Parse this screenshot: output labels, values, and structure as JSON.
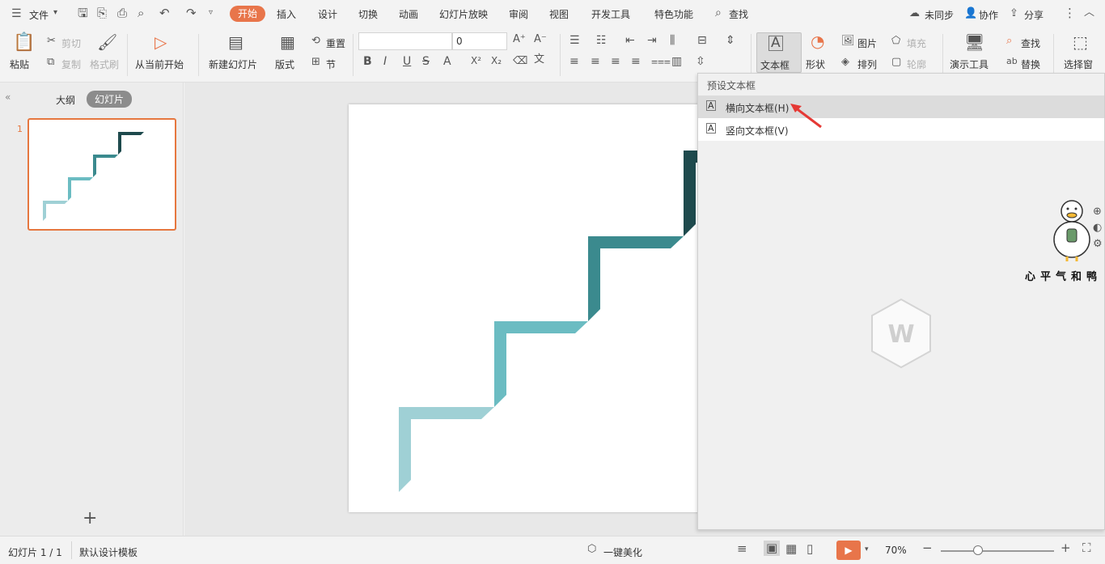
{
  "menubar": {
    "file": "文件",
    "tabs": [
      "开始",
      "插入",
      "设计",
      "切换",
      "动画",
      "幻灯片放映",
      "审阅",
      "视图",
      "开发工具",
      "特色功能"
    ],
    "active_tab": "开始",
    "search": "查找",
    "sync": "未同步",
    "collab": "协作",
    "share": "分享"
  },
  "ribbon": {
    "paste": "粘贴",
    "cut": "剪切",
    "copy": "复制",
    "format_painter": "格式刷",
    "from_current": "从当前开始",
    "new_slide": "新建幻灯片",
    "layout": "版式",
    "reset": "重置",
    "section": "节",
    "font_size": "0",
    "textbox": "文本框",
    "shape": "形状",
    "picture": "图片",
    "fill": "填充",
    "arrange": "排列",
    "outline": "轮廓",
    "present_tools": "演示工具",
    "find": "查找",
    "replace": "替换",
    "select_pane": "选择窗"
  },
  "panel": {
    "outline_tab": "大纲",
    "slides_tab": "幻灯片",
    "slide_number": "1",
    "add_icon": "plus-icon"
  },
  "dropdown": {
    "header": "预设文本框",
    "items": [
      {
        "label": "横向文本框(H)",
        "icon": "horizontal-textbox-icon"
      },
      {
        "label": "竖向文本框(V)",
        "icon": "vertical-textbox-icon"
      }
    ]
  },
  "watermark": {
    "caption": "心平气和鸭"
  },
  "status": {
    "slide_info": "幻灯片 1 / 1",
    "template": "默认设计模板",
    "beautify": "一键美化",
    "zoom": "70%"
  },
  "colors": {
    "accent": "#e8754a",
    "step_light": "#9fd0d5",
    "step_mid": "#6bbcc2",
    "step_teal": "#3b8a8e",
    "step_dark": "#1e4a4d"
  }
}
